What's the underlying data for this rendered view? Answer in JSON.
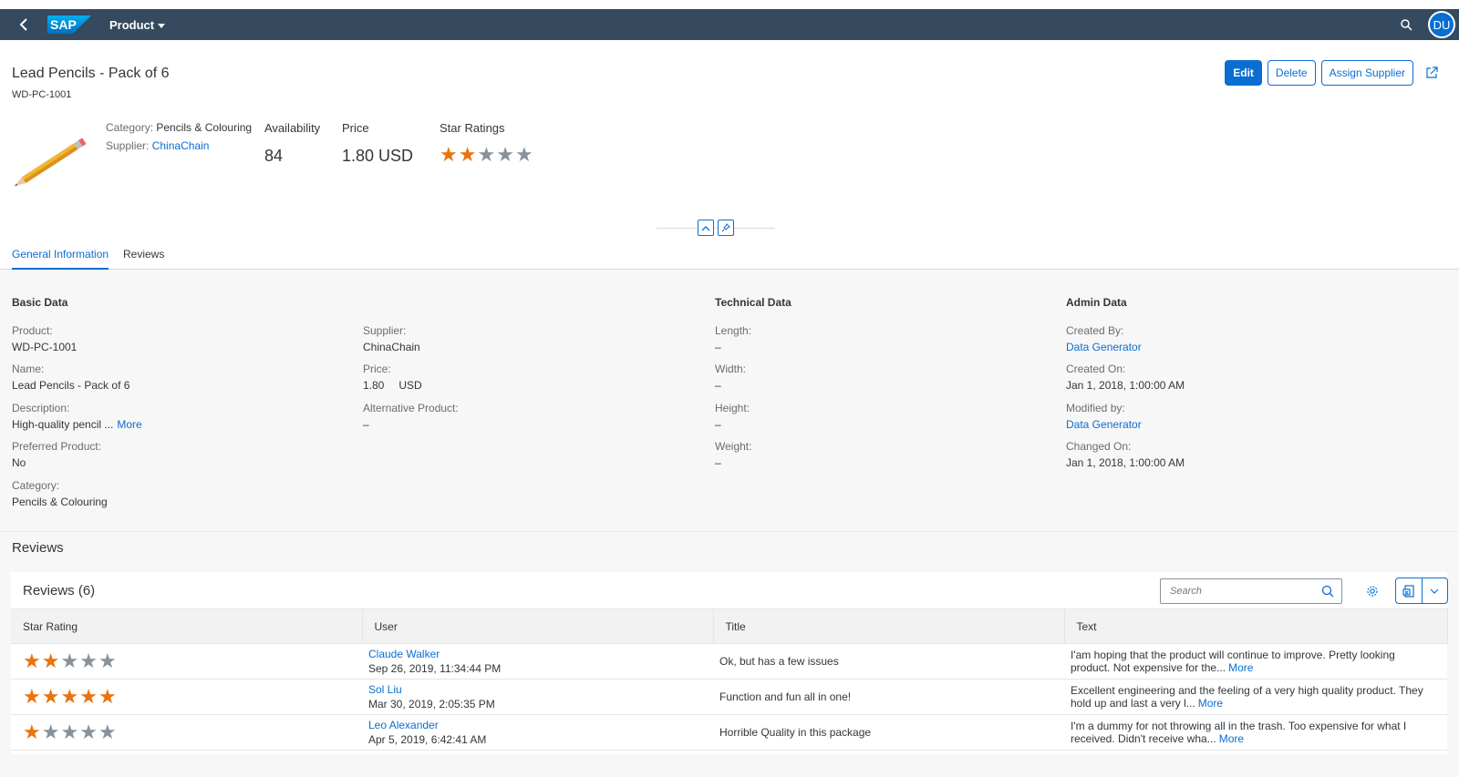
{
  "shell": {
    "app_title": "Product",
    "logo_text": "SAP",
    "avatar_initials": "DU"
  },
  "header": {
    "title": "Lead Pencils - Pack of 6",
    "subtitle": "WD-PC-1001",
    "actions": {
      "edit": "Edit",
      "delete": "Delete",
      "assign_supplier": "Assign Supplier"
    },
    "category_label": "Category:",
    "category_value": "Pencils & Colouring",
    "supplier_label": "Supplier:",
    "supplier_value": "ChinaChain",
    "kpis": {
      "availability_label": "Availability",
      "availability_value": "84",
      "price_label": "Price",
      "price_value": "1.80 USD",
      "star_label": "Star Ratings",
      "star_rating": 2,
      "star_max": 5
    }
  },
  "tabs": [
    {
      "label": "General Information",
      "active": true
    },
    {
      "label": "Reviews",
      "active": false
    }
  ],
  "general": {
    "basic_title": "Basic Data",
    "technical_title": "Technical Data",
    "admin_title": "Admin Data",
    "basic_col1": [
      {
        "label": "Product:",
        "value": "WD-PC-1001"
      },
      {
        "label": "Name:",
        "value": "Lead Pencils - Pack of 6"
      },
      {
        "label": "Description:",
        "value": "High-quality pencil ...",
        "more": "More"
      },
      {
        "label": "Preferred Product:",
        "value": "No"
      },
      {
        "label": "Category:",
        "value": "Pencils & Colouring"
      }
    ],
    "basic_col2": [
      {
        "label": "Supplier:",
        "value": "ChinaChain"
      },
      {
        "label": "Price:",
        "value": "1.80",
        "unit": "USD"
      },
      {
        "label": "Alternative Product:",
        "value": "–"
      }
    ],
    "technical": [
      {
        "label": "Length:",
        "value": "–"
      },
      {
        "label": "Width:",
        "value": "–"
      },
      {
        "label": "Height:",
        "value": "–"
      },
      {
        "label": "Weight:",
        "value": "–"
      }
    ],
    "admin": [
      {
        "label": "Created By:",
        "value": "Data Generator"
      },
      {
        "label": "Created On:",
        "value": "Jan 1, 2018, 1:00:00 AM"
      },
      {
        "label": "Modified by:",
        "value": "Data Generator"
      },
      {
        "label": "Changed On:",
        "value": "Jan 1, 2018, 1:00:00 AM"
      }
    ]
  },
  "reviews": {
    "section_title": "Reviews",
    "table_title": "Reviews (6)",
    "search_placeholder": "Search",
    "columns": [
      "Star Rating",
      "User",
      "Title",
      "Text"
    ],
    "rows": [
      {
        "rating": 2,
        "user": "Claude Walker",
        "date": "Sep 26, 2019, 11:34:44 PM",
        "title": "Ok, but has a few issues",
        "text": "I'am hoping that the product will continue to improve. Pretty looking product. Not expensive for the...",
        "more": "More"
      },
      {
        "rating": 5,
        "user": "Sol Liu",
        "date": "Mar 30, 2019, 2:05:35 PM",
        "title": "Function and fun all in one!",
        "text": "Excellent engineering and the feeling of a very high quality product. They hold up and last a very l...",
        "more": "More"
      },
      {
        "rating": 1,
        "user": "Leo Alexander",
        "date": "Apr 5, 2019, 6:42:41 AM",
        "title": "Horrible Quality in this package",
        "text": "I'm a dummy for not throwing all in the trash. Too expensive for what I received. Didn't receive wha...",
        "more": "More"
      }
    ]
  },
  "colors": {
    "shell": "#354a5f",
    "accent": "#0a6ed1",
    "star_on": "#e9730c",
    "star_off": "#89919a"
  }
}
